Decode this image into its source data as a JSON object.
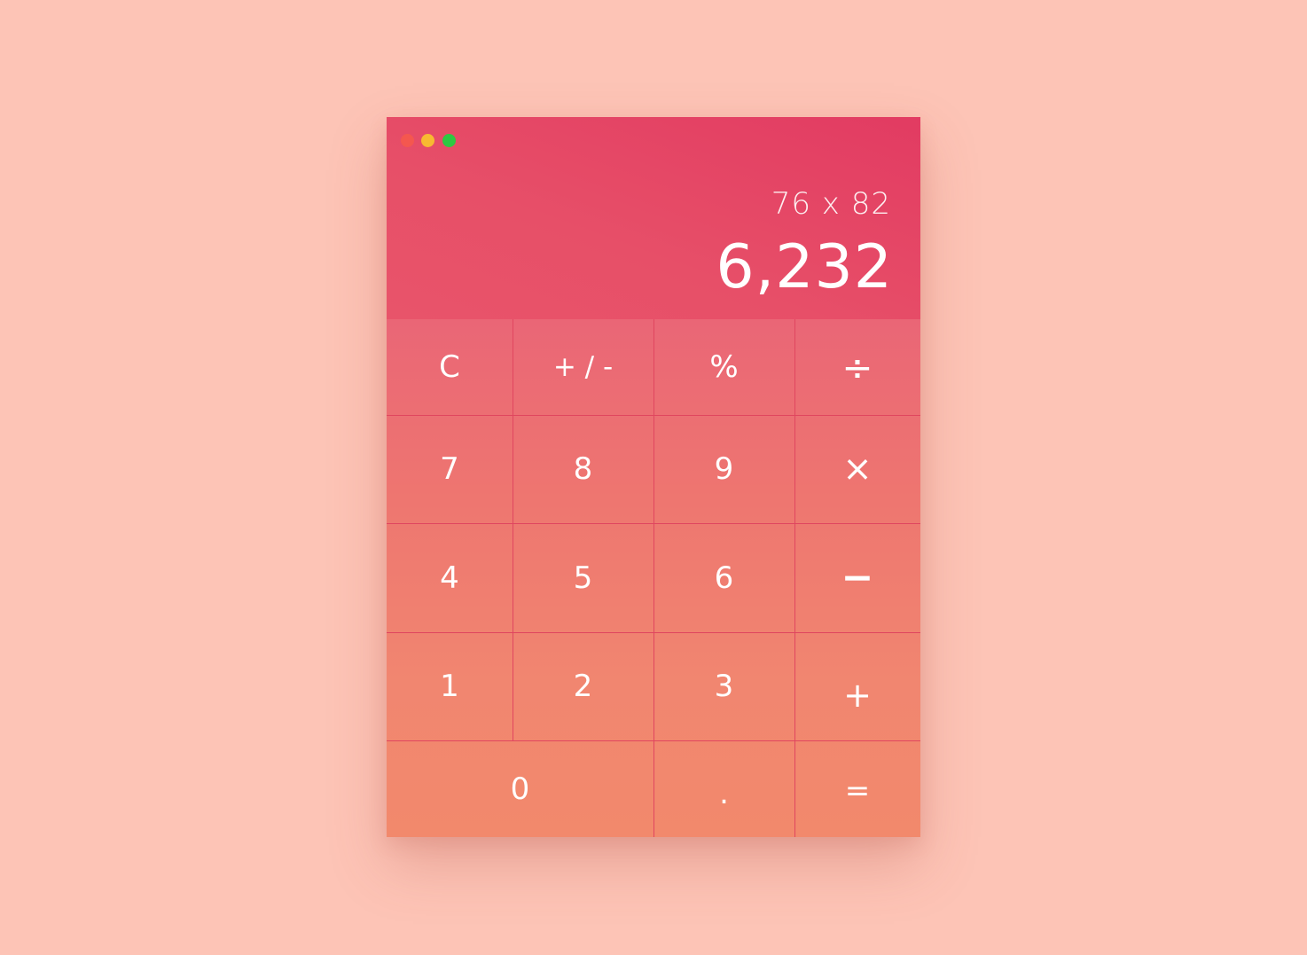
{
  "window": {
    "traffic_lights": [
      {
        "name": "close",
        "color": "#f4574f"
      },
      {
        "name": "minimize",
        "color": "#f8b931"
      },
      {
        "name": "zoom",
        "color": "#2ec842"
      }
    ]
  },
  "display": {
    "expression": "76 x 82",
    "result": "6,232"
  },
  "keys": {
    "clear": "C",
    "plus_minus": "+ / -",
    "percent": "%",
    "divide": "÷",
    "seven": "7",
    "eight": "8",
    "nine": "9",
    "multiply": "×",
    "four": "4",
    "five": "5",
    "six": "6",
    "subtract": "−",
    "one": "1",
    "two": "2",
    "three": "3",
    "add": "+",
    "zero": "0",
    "decimal": ".",
    "equals": "="
  },
  "colors": {
    "background": "#fdc4b6",
    "display_top": "#e23b62",
    "keypad_bottom": "#f2896c",
    "divider": "#e0465f"
  }
}
